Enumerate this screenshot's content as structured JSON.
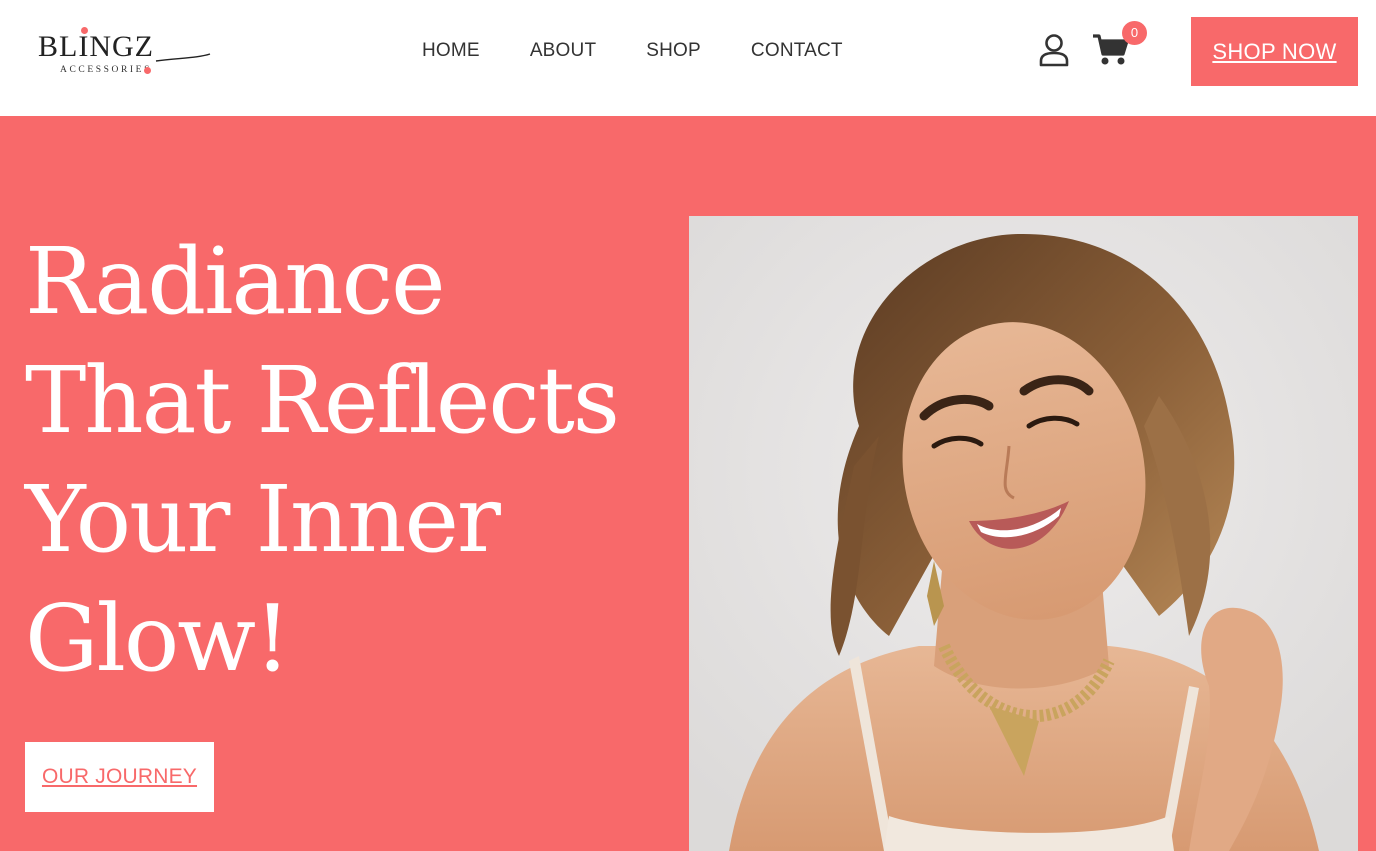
{
  "brand": {
    "logo_main": "BLINGZ",
    "logo_sub": "ACCESSORIES",
    "accent_color": "#f8696a"
  },
  "nav": {
    "items": [
      {
        "label": "HOME"
      },
      {
        "label": "ABOUT"
      },
      {
        "label": "SHOP"
      },
      {
        "label": "CONTACT"
      }
    ]
  },
  "header": {
    "user_icon": "user-icon",
    "cart_icon": "cart-icon",
    "cart_count": "0",
    "cta_label": "SHOP NOW"
  },
  "hero": {
    "title_lines": [
      "Radiance",
      "That Reflects",
      "Your Inner",
      "Glow!"
    ],
    "button_label": "OUR JOURNEY"
  }
}
